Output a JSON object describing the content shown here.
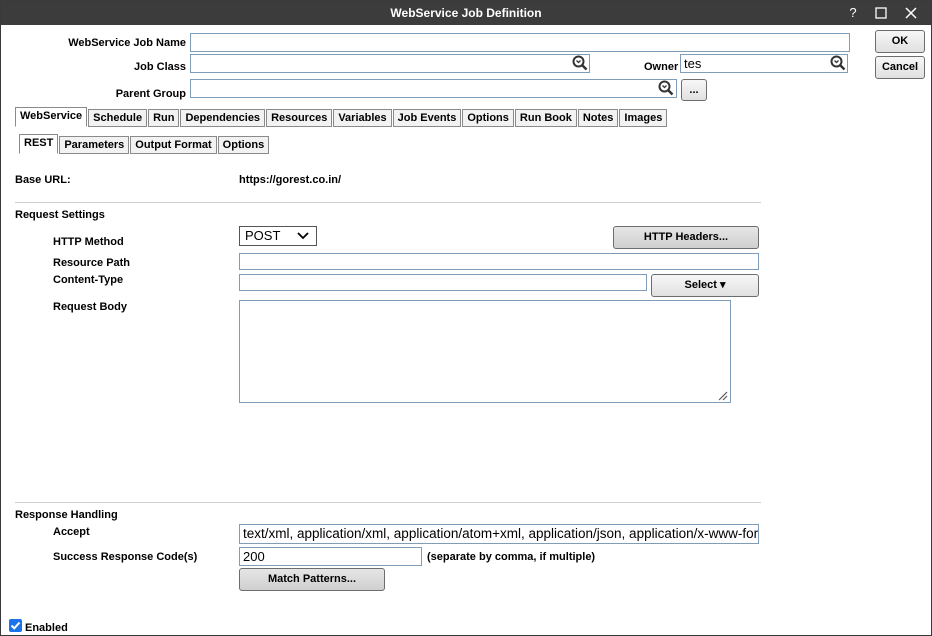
{
  "window": {
    "title": "WebService Job Definition",
    "help_label": "?",
    "maximize_label": "☐",
    "close_label": "✕"
  },
  "header": {
    "job_name_label": "WebService Job Name",
    "job_name_value": "",
    "job_class_label": "Job Class",
    "job_class_value": "",
    "owner_label": "Owner",
    "owner_value": "tes",
    "parent_group_label": "Parent Group",
    "parent_group_value": "",
    "browse_label": "...",
    "ok_label": "OK",
    "cancel_label": "Cancel"
  },
  "main_tabs": [
    {
      "label": "WebService"
    },
    {
      "label": "Schedule"
    },
    {
      "label": "Run"
    },
    {
      "label": "Dependencies"
    },
    {
      "label": "Resources"
    },
    {
      "label": "Variables"
    },
    {
      "label": "Job Events"
    },
    {
      "label": "Options"
    },
    {
      "label": "Run Book"
    },
    {
      "label": "Notes"
    },
    {
      "label": "Images"
    }
  ],
  "sub_tabs": [
    {
      "label": "REST"
    },
    {
      "label": "Parameters"
    },
    {
      "label": "Output Format"
    },
    {
      "label": "Options"
    }
  ],
  "base_url": {
    "label": "Base URL:",
    "value": "https://gorest.co.in/"
  },
  "request": {
    "section_label": "Request Settings",
    "http_method_label": "HTTP Method",
    "http_method_value": "POST",
    "http_headers_button": "HTTP Headers...",
    "resource_path_label": "Resource Path",
    "resource_path_value": "",
    "content_type_label": "Content-Type",
    "content_type_value": "",
    "select_button": "Select ▾",
    "request_body_label": "Request Body",
    "request_body_value": ""
  },
  "response": {
    "section_label": "Response Handling",
    "accept_label": "Accept",
    "accept_value": "text/xml, application/xml, application/atom+xml, application/json, application/x-www-form-u",
    "success_codes_label": "Success Response Code(s)",
    "success_codes_value": "200",
    "success_codes_hint": "(separate by comma, if multiple)",
    "match_patterns_button": "Match Patterns..."
  },
  "footer": {
    "enabled_label": "Enabled",
    "enabled_checked": true
  },
  "colors": {
    "titlebar": "#3c3c3c",
    "checkbox": "#1a73e8",
    "input_border": "#7f9db9"
  }
}
